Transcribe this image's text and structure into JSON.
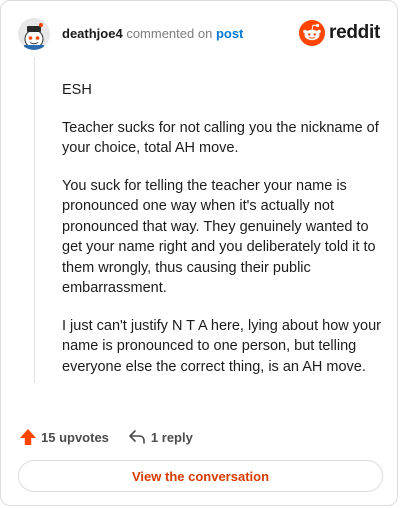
{
  "header": {
    "username": "deathjoe4",
    "action_text": "commented on",
    "post_link": "post",
    "brand_name": "reddit",
    "brand_color": "#ff4500"
  },
  "comment": {
    "paragraphs": [
      "ESH",
      "Teacher sucks for not calling you the nickname of your choice, total AH move.",
      "You suck for telling the teacher your name is pronounced one way when it's actually not pronounced that way. They genuinely wanted to get your name right and you deliberately told it to them wrongly, thus causing their public embarrassment.",
      "I just can't justify N T A here, lying about how your name is pronounced to one person, but telling everyone else the correct thing, is an AH move."
    ]
  },
  "actions": {
    "upvotes_label": "15 upvotes",
    "upvote_icon": "upvote-arrow-icon",
    "upvote_color": "#ff4500",
    "reply_label": "1 reply",
    "reply_icon": "reply-arrow-icon"
  },
  "cta": {
    "label": "View the conversation",
    "color": "#d93a00"
  }
}
